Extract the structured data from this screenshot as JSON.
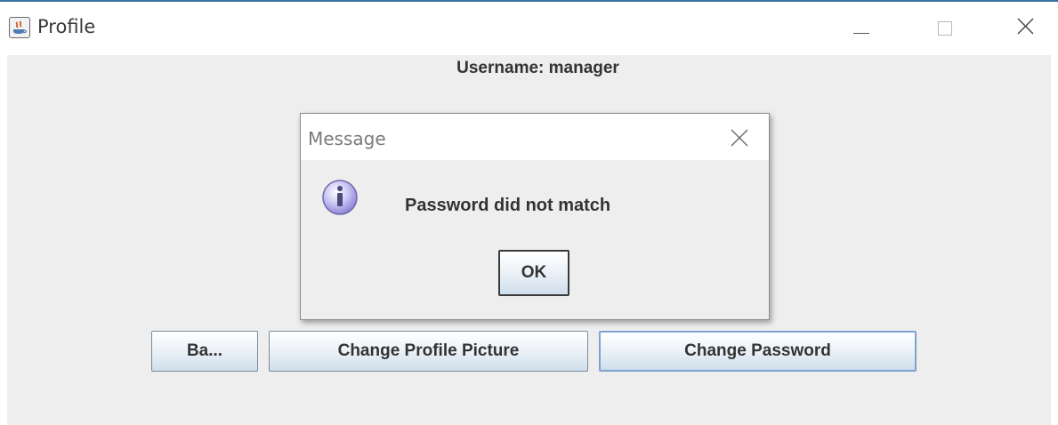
{
  "window": {
    "title": "Profile"
  },
  "profile": {
    "username_label": "Username: manager"
  },
  "buttons": {
    "back_label": "Ba...",
    "change_picture_label": "Change Profile Picture",
    "change_password_label": "Change Password"
  },
  "dialog": {
    "title": "Message",
    "message": "Password did not match",
    "ok_label": "OK",
    "icon": "info-icon"
  },
  "colors": {
    "panel_background": "#eeeeee",
    "button_gradient_bottom": "#cfdeeb",
    "focus_border": "#7da2ce",
    "info_icon_fill": "#c9c4f5"
  }
}
